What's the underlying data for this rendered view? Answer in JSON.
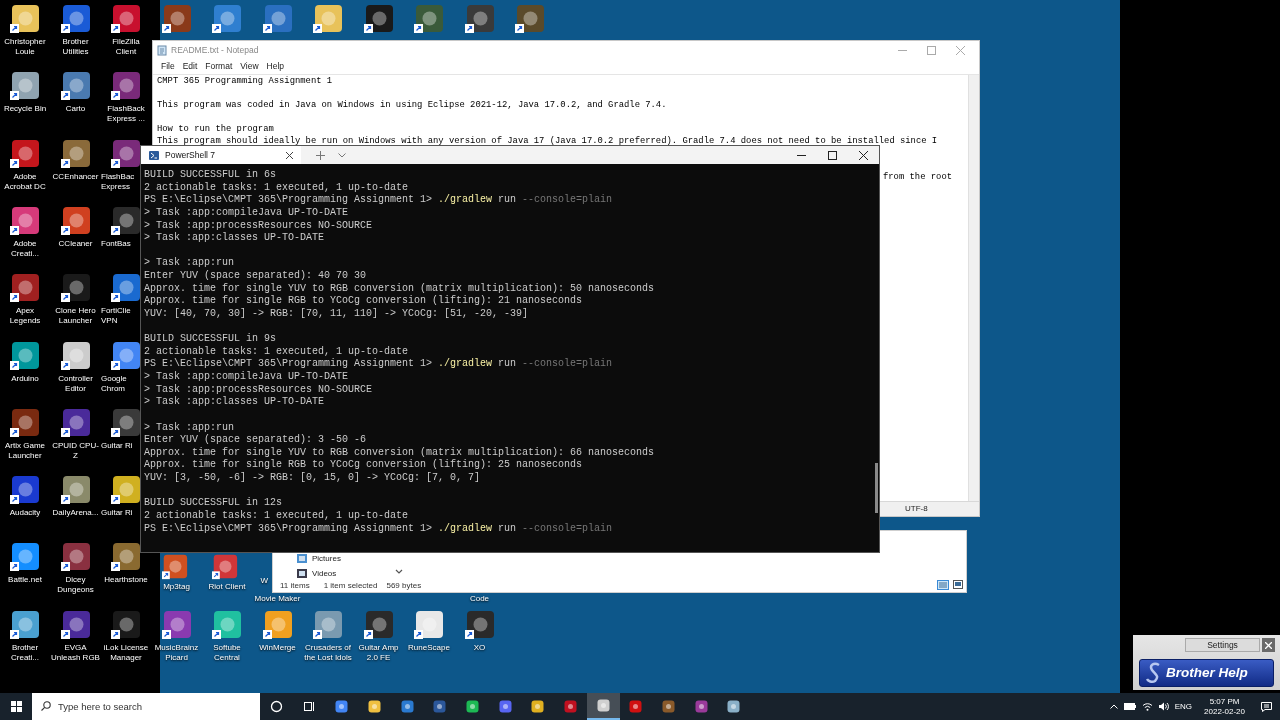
{
  "desktop_icons": [
    {
      "kind": "shortcut",
      "label": "Christopher Louie"
    },
    {
      "kind": "shortcut",
      "label": "Brother Utilities"
    },
    {
      "kind": "shortcut",
      "label": "FileZilla Client"
    },
    {
      "kind": "shortcut"
    },
    {
      "kind": "shortcut"
    },
    {
      "kind": "shortcut"
    },
    {
      "kind": "shortcut"
    },
    {
      "kind": "shortcut"
    },
    {
      "kind": "shortcut"
    },
    {
      "kind": "shortcut"
    },
    {
      "kind": "shortcut"
    },
    {
      "kind": "shortcut",
      "label": "Recycle Bin"
    },
    {
      "kind": "shortcut",
      "label": "Carto"
    },
    {
      "kind": "shortcut",
      "label": "FlashBack Express ..."
    },
    {
      "kind": "shortcut",
      "label": "Adobe Acrobat DC"
    },
    {
      "kind": "shortcut",
      "label": "CCEnhancer"
    },
    {
      "kind": "clipped",
      "label": "FlashBac Express"
    },
    {
      "kind": "shortcut",
      "label": "Adobe Creati..."
    },
    {
      "kind": "shortcut",
      "label": "CCleaner"
    },
    {
      "kind": "clipped",
      "label": "FontBas"
    },
    {
      "kind": "shortcut",
      "label": "Apex Legends"
    },
    {
      "kind": "shortcut",
      "label": "Clone Hero Launcher"
    },
    {
      "kind": "clipped",
      "label": "FortiClie VPN"
    },
    {
      "kind": "shortcut",
      "label": "Arduino"
    },
    {
      "kind": "shortcut",
      "label": "Controller Editor"
    },
    {
      "kind": "clipped",
      "label": "Google Chrom"
    },
    {
      "kind": "shortcut",
      "label": "Artix Game Launcher"
    },
    {
      "kind": "shortcut",
      "label": "CPUID CPU-Z"
    },
    {
      "kind": "clipped",
      "label": "Guitar Ri"
    },
    {
      "kind": "shortcut",
      "label": "Audacity"
    },
    {
      "kind": "shortcut",
      "label": "DailyArena..."
    },
    {
      "kind": "clipped",
      "label": "Guitar Ri"
    },
    {
      "kind": "shortcut",
      "label": "Battle.net"
    },
    {
      "kind": "shortcut",
      "label": "Dicey Dungeons"
    },
    {
      "kind": "shortcut",
      "label": "Hearthstone"
    },
    {
      "kind": "shortcut",
      "label": "Mp3tag"
    },
    {
      "kind": "shortcut",
      "label": "Riot Client"
    },
    {
      "kind": "partial",
      "cut_label": "W",
      "label": "Movie Maker"
    },
    {
      "kind": "partial",
      "label": "Code"
    },
    {
      "kind": "shortcut",
      "label": "Brother Creati..."
    },
    {
      "kind": "shortcut",
      "label": "EVGA Unleash RGB"
    },
    {
      "kind": "shortcut",
      "label": "iLok License Manager"
    },
    {
      "kind": "shortcut",
      "label": "MusicBrainz Picard"
    },
    {
      "kind": "shortcut",
      "label": "Softube Central"
    },
    {
      "kind": "shortcut",
      "label": "WinMerge"
    },
    {
      "kind": "shortcut",
      "label": "Crusaders of the Lost Idols"
    },
    {
      "kind": "shortcut",
      "label": "Guitar Amp 2.0 FE"
    },
    {
      "kind": "shortcut",
      "label": "RuneScape"
    },
    {
      "kind": "shortcut",
      "label": "XO"
    }
  ],
  "notepad": {
    "title": "README.txt - Notepad",
    "menu": [
      "File",
      "Edit",
      "Format",
      "View",
      "Help"
    ],
    "paragraphs": [
      [
        "CMPT 365 Programming Assignment 1"
      ],
      [
        "This program was coded in Java on Windows in using Eclipse 2021-12, Java 17.0.2, and Gradle 7.4."
      ],
      [
        "How to run the program",
        "This program should ideally be run on Windows with any version of Java 17 (Java 17.0.2 preferred). Gradle 7.4 does not need to be installed since I"
      ]
    ],
    "visible_fragment": "from the root",
    "encoding": "UTF-8"
  },
  "explorer": {
    "nav_items": [
      "Pictures",
      "Videos"
    ],
    "item_count": "11 items",
    "selection": "1 item selected",
    "size": "569 bytes"
  },
  "terminal": {
    "tab": "PowerShell 7",
    "blocks": [
      [
        {
          "text": "BUILD SUCCESSFUL in 6s"
        },
        {
          "text": "2 actionable tasks: 1 executed, 1 up-to-date"
        },
        {
          "prompt": "PS E:\\Eclipse\\CMPT 365\\Programming Assignment 1>",
          "command": "./gradlew",
          "argument": "run",
          "flag": "--console=plain"
        },
        {
          "text": "> Task :app:compileJava UP-TO-DATE"
        },
        {
          "text": "> Task :app:processResources NO-SOURCE"
        },
        {
          "text": "> Task :app:classes UP-TO-DATE"
        }
      ],
      [
        {
          "text": "> Task :app:run"
        },
        {
          "text": "Enter YUV (space separated): 40 70 30"
        },
        {
          "text": "Approx. time for single YUV to RGB conversion (matrix multiplication): 50 nanoseconds"
        },
        {
          "text": "Approx. time for single RGB to YCoCg conversion (lifting): 21 nanoseconds"
        },
        {
          "text": "YUV: [40, 70, 30] -> RGB: [70, 11, 110] -> YCoCg: [51, -20, -39]"
        }
      ],
      [
        {
          "text": "BUILD SUCCESSFUL in 9s"
        },
        {
          "text": "2 actionable tasks: 1 executed, 1 up-to-date"
        },
        {
          "prompt": "PS E:\\Eclipse\\CMPT 365\\Programming Assignment 1>",
          "command": "./gradlew",
          "argument": "run",
          "flag": "--console=plain"
        },
        {
          "text": "> Task :app:compileJava UP-TO-DATE"
        },
        {
          "text": "> Task :app:processResources NO-SOURCE"
        },
        {
          "text": "> Task :app:classes UP-TO-DATE"
        }
      ],
      [
        {
          "text": "> Task :app:run"
        },
        {
          "text": "Enter YUV (space separated): 3 -50 -6"
        },
        {
          "text": "Approx. time for single YUV to RGB conversion (matrix multiplication): 66 nanoseconds"
        },
        {
          "text": "Approx. time for single RGB to YCoCg conversion (lifting): 25 nanoseconds"
        },
        {
          "text": "YUV: [3, -50, -6] -> RGB: [0, 15, 0] -> YCoCg: [7, 0, 7]"
        }
      ],
      [
        {
          "text": "BUILD SUCCESSFUL in 12s"
        },
        {
          "text": "2 actionable tasks: 1 executed, 1 up-to-date"
        },
        {
          "prompt": "PS E:\\Eclipse\\CMPT 365\\Programming Assignment 1>",
          "command": "./gradlew",
          "argument": "run",
          "flag": "--console=plain"
        }
      ]
    ]
  },
  "brother_help": {
    "settings": "Settings",
    "button": "Brother Help"
  },
  "taskbar": {
    "search": {
      "placeholder": "Type here to search"
    },
    "apps": [
      {
        "selected": false
      },
      {
        "selected": false
      },
      {
        "selected": false
      },
      {
        "selected": false
      },
      {
        "selected": false
      },
      {
        "selected": false
      },
      {
        "selected": false
      },
      {
        "selected": false
      },
      {
        "selected": false
      },
      {
        "selected": false
      },
      {
        "selected": true
      },
      {
        "selected": false
      },
      {
        "selected": false
      },
      {
        "selected": false
      },
      {
        "selected": false
      }
    ],
    "language": "ENG",
    "time": "5:07 PM",
    "date": "2022-02-20"
  }
}
